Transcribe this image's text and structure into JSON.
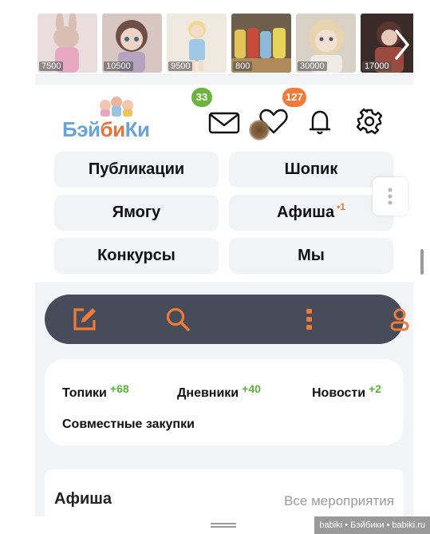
{
  "thumbnails": [
    {
      "price": "7500",
      "colors": [
        "#e8c9d0",
        "#cfb2a6",
        "#f2e6e6"
      ]
    },
    {
      "price": "10500",
      "colors": [
        "#8c6f6a",
        "#d9b6b0",
        "#5a4a4a"
      ]
    },
    {
      "price": "9500",
      "colors": [
        "#e9e3d8",
        "#9cc4dc",
        "#f5d68c"
      ]
    },
    {
      "price": "800",
      "colors": [
        "#7a6a55",
        "#e3c25a",
        "#c84a3a"
      ]
    },
    {
      "price": "30000",
      "colors": [
        "#d8cfc0",
        "#e8d7b8",
        "#b09878"
      ]
    },
    {
      "price": "17000",
      "colors": [
        "#5a3a34",
        "#a7685a",
        "#2e2424"
      ]
    }
  ],
  "logo": {
    "part1": "Бэй",
    "part2": "би",
    "part3": "Ки"
  },
  "header": {
    "mail_count": "33",
    "notif_count": "127"
  },
  "nav": {
    "publications": "Публикации",
    "shop": "Шопик",
    "yamogu": "Ямогу",
    "afisha": "Афиша",
    "afisha_sup": "•1",
    "contests": "Конкурсы",
    "we": "Мы"
  },
  "feed": {
    "topics": "Топики",
    "topics_count": "+68",
    "diaries": "Дневники",
    "diaries_count": "+40",
    "news": "Новости",
    "news_count": "+2",
    "joint": "Совместные закупки"
  },
  "afisha": {
    "title": "Афиша",
    "all_events": "Все мероприятия"
  },
  "watermark": "babiki • Бэйбики • babiki.ru",
  "colors": {
    "accent": "#f07a3a",
    "green": "#5bb23a",
    "bar": "#464c59",
    "logo_blue": "#6aa3d8"
  }
}
